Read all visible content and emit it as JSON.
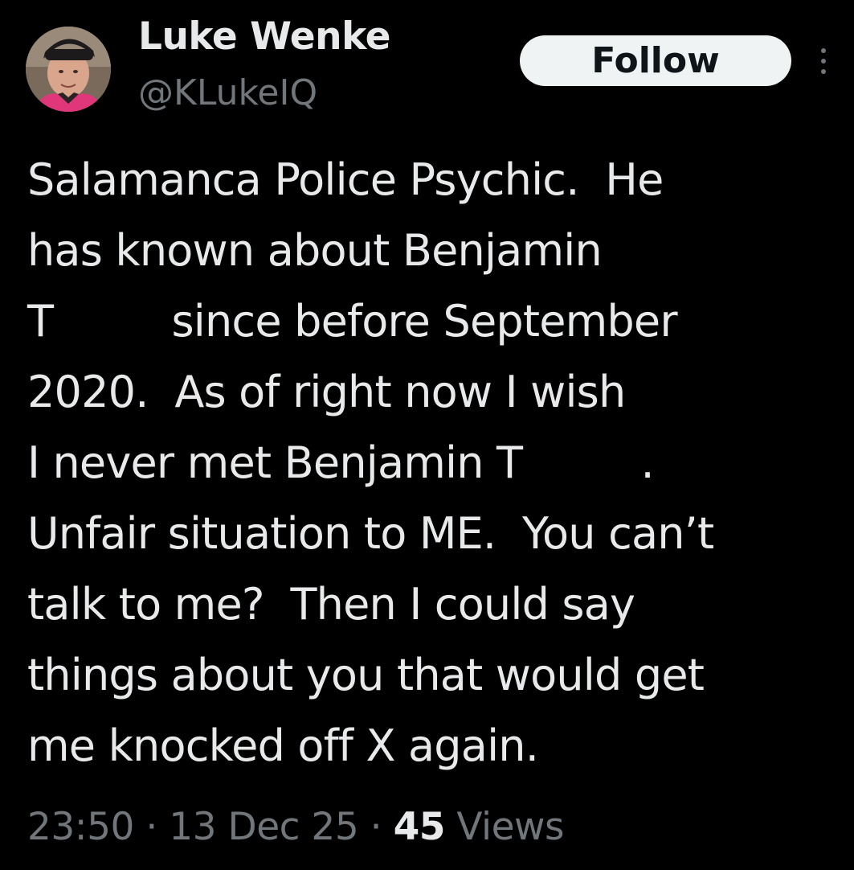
{
  "author": {
    "display_name": "Luke Wenke",
    "handle": "@KLukeIQ",
    "avatar": "profile-photo"
  },
  "actions": {
    "follow_label": "Follow",
    "more_icon": "more-vertical-icon"
  },
  "tweet": {
    "lines": [
      "Salamanca Police Psychic.  He",
      "has known about Benjamin",
      "T         since before September",
      "2020.  As of right now I wish",
      "I never met Benjamin T         .",
      "Unfair situation to ME.  You can’t",
      "talk to me?  Then I could say",
      "things about you that would get",
      "me knocked off X again."
    ]
  },
  "meta": {
    "time": "23:50",
    "separator": " · ",
    "date": "13 Dec 25",
    "views_count": "45",
    "views_label": " Views"
  },
  "colors": {
    "background": "#000000",
    "primary_text": "#e7e9ea",
    "secondary_text": "#71767b",
    "follow_button_bg": "#eff3f4",
    "follow_button_text": "#0f1419"
  }
}
